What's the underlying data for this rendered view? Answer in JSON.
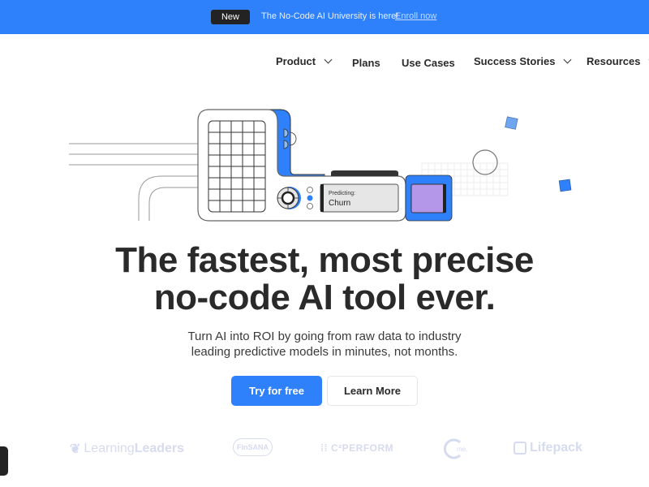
{
  "announcement": {
    "badge": "New",
    "message": "The No-Code AI University is here!",
    "link": "Enroll now",
    "background_color": "#2f80fb"
  },
  "nav": {
    "items": [
      {
        "label": "Product",
        "has_dropdown": true
      },
      {
        "label": "Plans",
        "has_dropdown": false
      },
      {
        "label": "Use Cases",
        "has_dropdown": false
      },
      {
        "label": "Success Stories",
        "has_dropdown": true
      },
      {
        "label": "Resources",
        "has_dropdown": true
      }
    ]
  },
  "illustration": {
    "display_label": "Predicting:",
    "display_value": "Churn",
    "accent_color": "#2f80fb",
    "screen_color": "#b597ea"
  },
  "hero": {
    "title_line1": "The fastest, most precise",
    "title_line2": "no-code AI tool ever.",
    "subtitle_line1": "Turn AI into ROI by going from raw data to industry",
    "subtitle_line2": "leading predictive models in minutes, not months.",
    "primary_cta": "Try for free",
    "secondary_cta": "Learn More"
  },
  "logos": [
    {
      "name": "LearningLeaders",
      "part1": "Learning",
      "part2": "Leaders"
    },
    {
      "name": "FinSANA"
    },
    {
      "name": "C2PERFORM",
      "text": "C²PERFORM"
    },
    {
      "name": "me",
      "text": "me."
    },
    {
      "name": "Lifepack"
    }
  ]
}
